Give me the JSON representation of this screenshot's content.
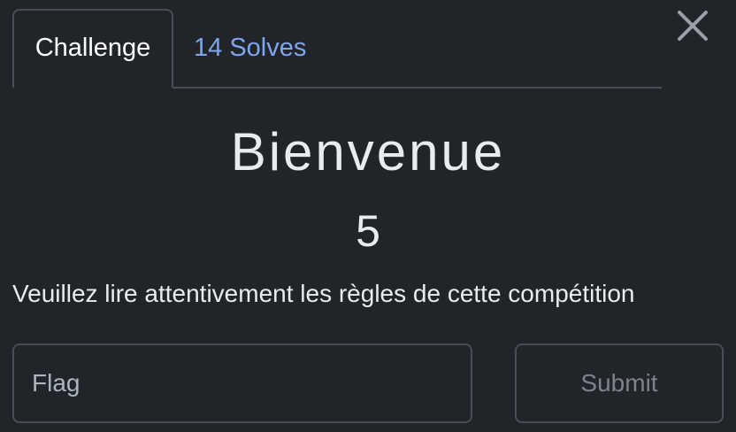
{
  "tabs": [
    {
      "label": "Challenge",
      "active": true
    },
    {
      "label": "14 Solves",
      "active": false
    }
  ],
  "close_icon": "close-icon",
  "challenge": {
    "title": "Bienvenue",
    "value": "5",
    "description": "Veuillez lire attentivement les règles de cette compétition"
  },
  "form": {
    "flag_placeholder": "Flag",
    "flag_value": "",
    "submit_label": "Submit"
  },
  "colors": {
    "background": "#212529",
    "border": "#4a4e54",
    "link": "#7ea6ef",
    "text": "#e9ecef",
    "muted": "#7d838a"
  }
}
